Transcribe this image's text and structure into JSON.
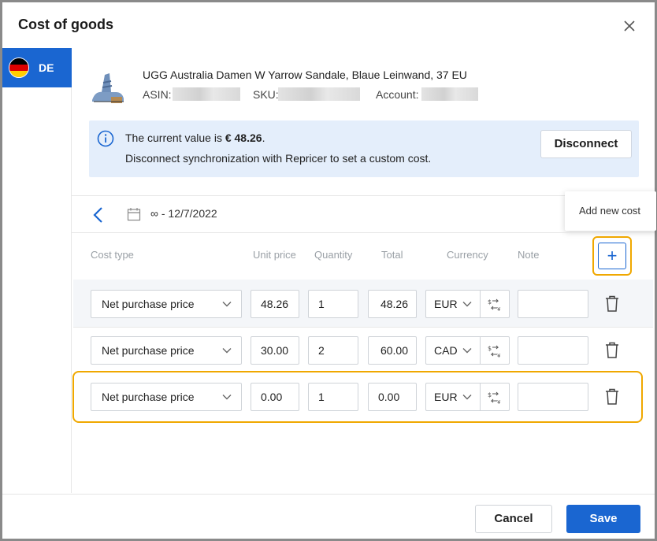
{
  "dialog": {
    "title": "Cost of goods",
    "close_icon": "close-icon"
  },
  "sidebar": {
    "tabs": [
      {
        "label": "DE",
        "flag": "germany-flag",
        "selected": true
      }
    ]
  },
  "product": {
    "name": "UGG Australia Damen W Yarrow Sandale, Blaue Leinwand, 37 EU",
    "asin_label": "ASIN:",
    "sku_label": "SKU:",
    "account_label": "Account:"
  },
  "info": {
    "icon": "info-icon",
    "line1_prefix": "The current value is ",
    "line1_value": "€ 48.26",
    "line1_suffix": ".",
    "line2": "Disconnect synchronization with Repricer to set a custom cost.",
    "disconnect_label": "Disconnect"
  },
  "period": {
    "back_icon": "chevron-left-icon",
    "calendar_icon": "calendar-icon",
    "range": "∞ - 12/7/2022"
  },
  "tooltip": {
    "text": "Add new cost"
  },
  "table": {
    "headers": {
      "cost_type": "Cost type",
      "unit_price": "Unit price",
      "quantity": "Quantity",
      "total": "Total",
      "currency": "Currency",
      "note": "Note"
    },
    "add_label": "+",
    "rows": [
      {
        "cost_type": "Net purchase price",
        "unit_price": "48.26",
        "quantity": "1",
        "total": "48.26",
        "currency": "EUR",
        "note": ""
      },
      {
        "cost_type": "Net purchase price",
        "unit_price": "30.00",
        "quantity": "2",
        "total": "60.00",
        "currency": "CAD",
        "note": ""
      },
      {
        "cost_type": "Net purchase price",
        "unit_price": "0.00",
        "quantity": "1",
        "total": "0.00",
        "currency": "EUR",
        "note": ""
      }
    ]
  },
  "footer": {
    "cancel_label": "Cancel",
    "save_label": "Save"
  },
  "colors": {
    "accent": "#1a66d1",
    "highlight": "#f0a800",
    "info_bg": "#e4eefb"
  }
}
